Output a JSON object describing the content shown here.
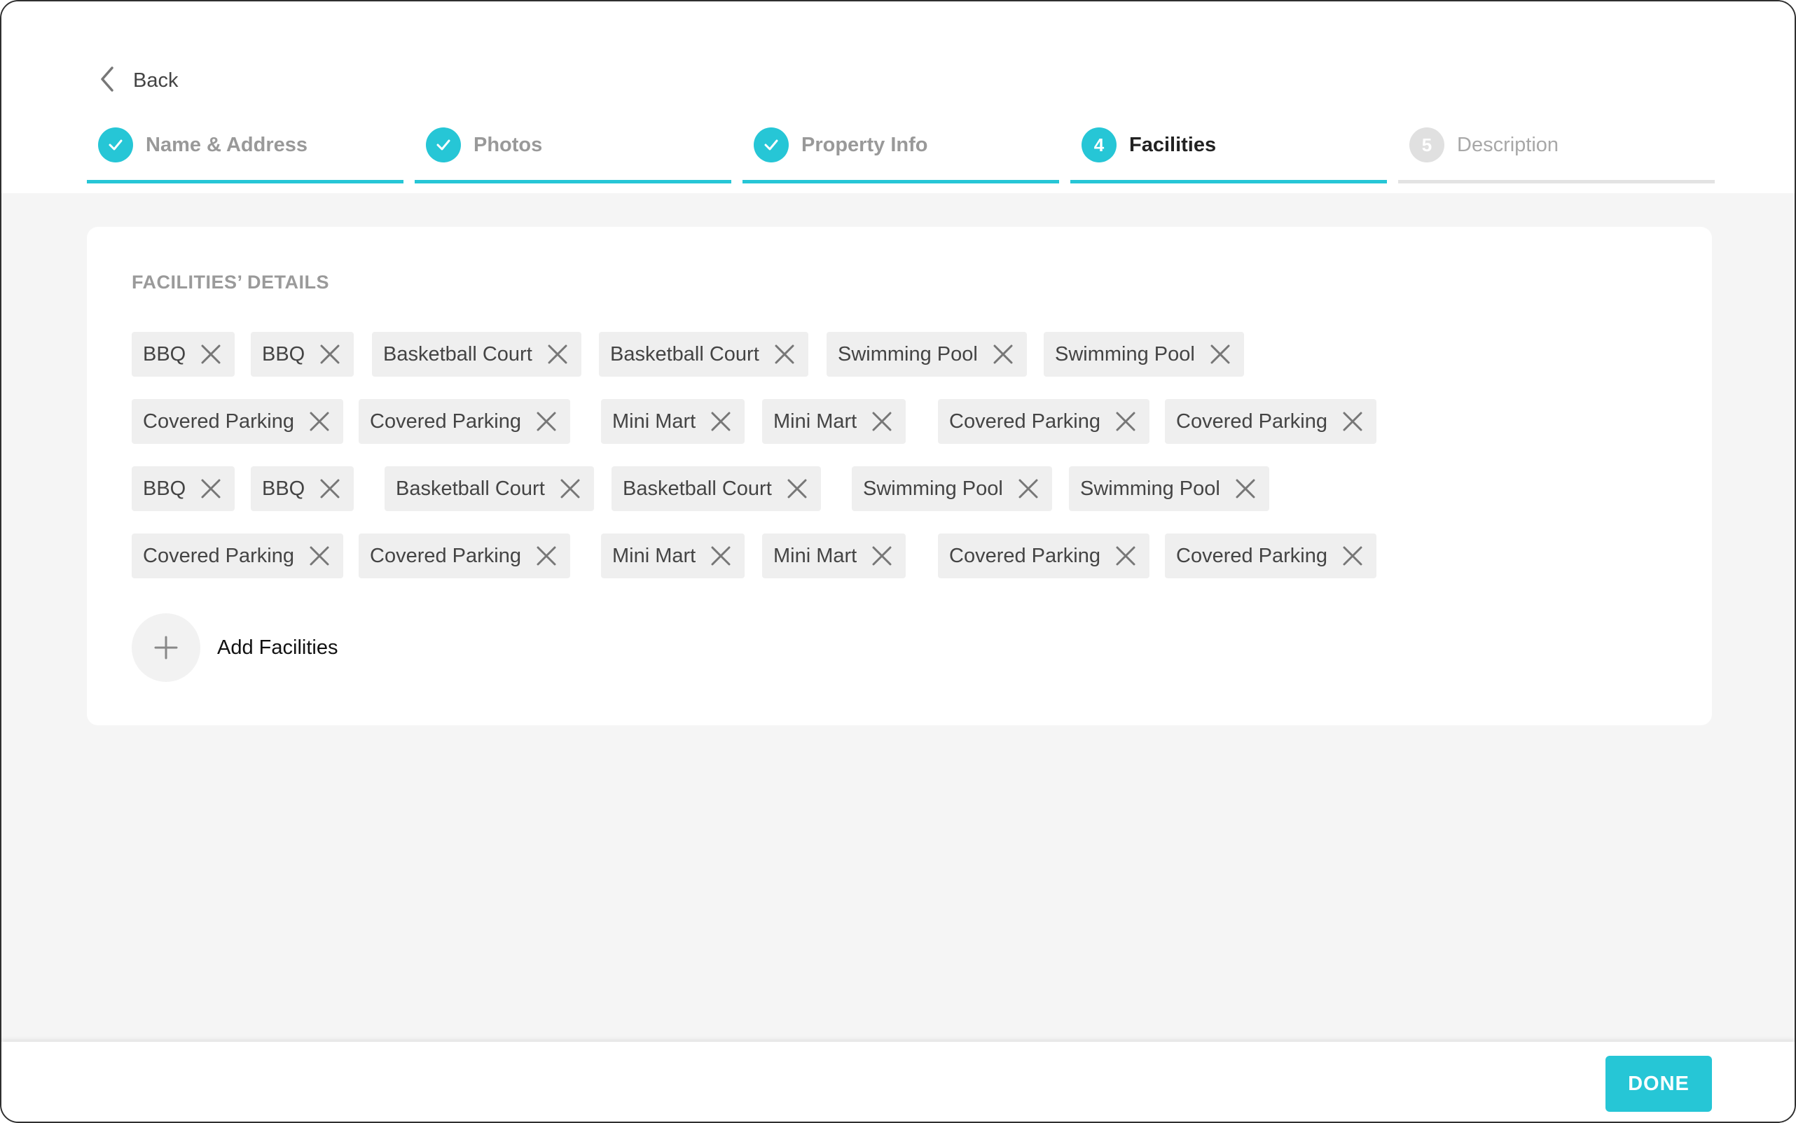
{
  "header": {
    "back_label": "Back",
    "steps": [
      {
        "number": "1",
        "label": "Name & Address",
        "status": "completed"
      },
      {
        "number": "2",
        "label": "Photos",
        "status": "completed"
      },
      {
        "number": "3",
        "label": "Property Info",
        "status": "completed"
      },
      {
        "number": "4",
        "label": "Facilities",
        "status": "active"
      },
      {
        "number": "5",
        "label": "Description",
        "status": "pending"
      }
    ]
  },
  "main": {
    "section_title": "FACILITIES’ DETAILS",
    "facility_rows": [
      [
        "BBQ",
        "BBQ",
        "Basketball Court",
        "Basketball Court",
        "Swimming Pool",
        "Swimming Pool"
      ],
      [
        "Covered Parking",
        "Covered Parking",
        "Mini Mart",
        "Mini Mart",
        "Covered Parking",
        "Covered Parking"
      ],
      [
        "BBQ",
        "BBQ",
        "Basketball Court",
        "Basketball Court",
        "Swimming Pool",
        "Swimming Pool"
      ],
      [
        "Covered Parking",
        "Covered Parking",
        "Mini Mart",
        "Mini Mart",
        "Covered Parking",
        "Covered Parking"
      ]
    ],
    "add_label": "Add Facilities"
  },
  "footer": {
    "done_label": "DONE"
  },
  "colors": {
    "accent": "#26c6d6",
    "pending": "#e0e0e0",
    "background": "#f5f5f5",
    "chip": "#efefef"
  }
}
